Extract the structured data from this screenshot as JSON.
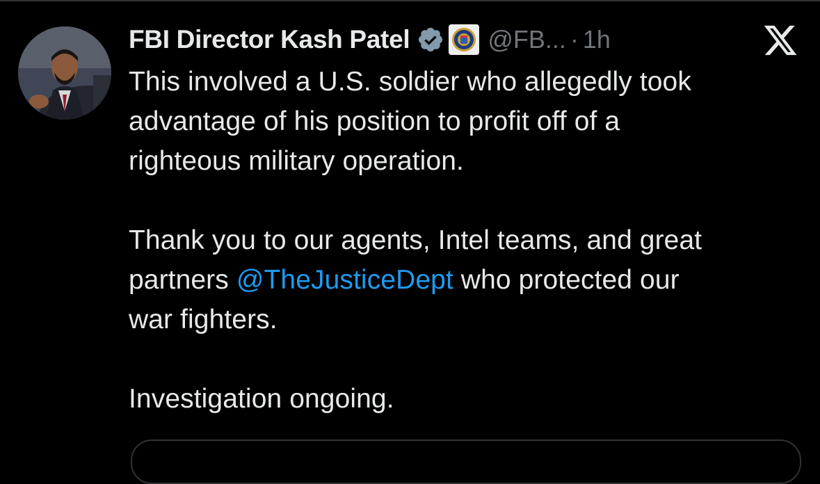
{
  "tweet": {
    "author": {
      "display_name": "FBI Director Kash Patel",
      "handle": "@FB...",
      "avatar_icon": "profile-photo",
      "verified_icon": "verified-badge-icon",
      "affiliation_icon": "fbi-seal-icon"
    },
    "separator": "·",
    "timestamp": "1h",
    "paragraph_1": {
      "lines": [
        "This involved a U.S. soldier who allegedly took",
        "advantage of his position to profit off of a",
        "righteous military operation."
      ]
    },
    "paragraph_2": {
      "line_1": "Thank you to our agents, Intel teams, and great",
      "line_2_before": "partners ",
      "mention": "@TheJusticeDept",
      "line_2_after": " who protected our",
      "line_3": "war fighters."
    },
    "paragraph_3": "Investigation ongoing."
  },
  "brand": {
    "icon": "x-logo-icon"
  },
  "colors": {
    "background": "#000000",
    "text": "#e7e9ea",
    "secondary": "#71767b",
    "link": "#1d9bf0",
    "verified": "#829aab"
  }
}
